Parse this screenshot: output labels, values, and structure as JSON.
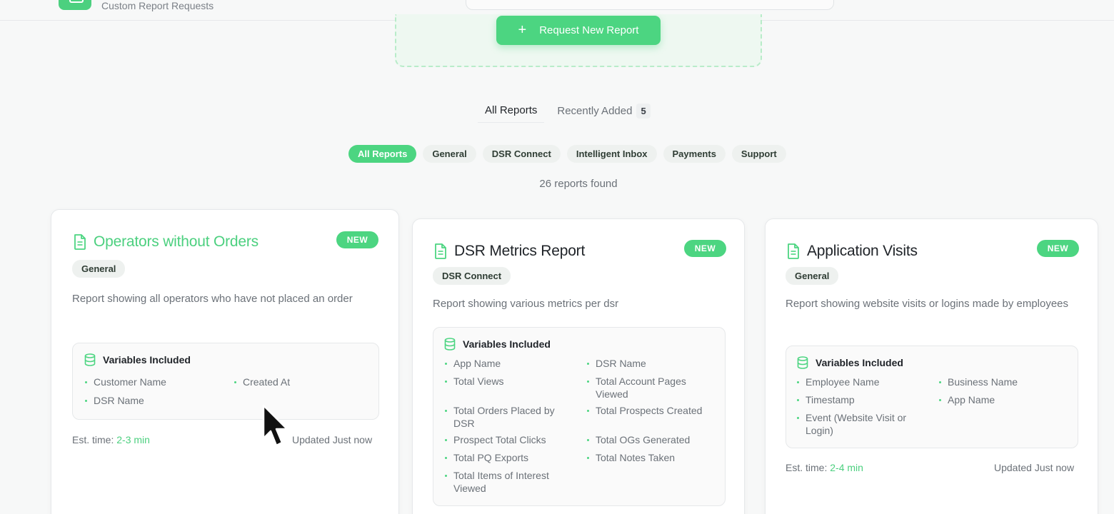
{
  "header": {
    "subtitle": "Custom Report Requests"
  },
  "request_button": {
    "label": "Request New Report",
    "plus": "+"
  },
  "tabs": [
    {
      "label": "All Reports"
    },
    {
      "label": "Recently Added",
      "count": "5"
    }
  ],
  "filters": [
    "All Reports",
    "General",
    "DSR Connect",
    "Intelligent Inbox",
    "Payments",
    "Support"
  ],
  "reports_found": "26 reports found",
  "cards": [
    {
      "title": "Operators without Orders",
      "badge": "NEW",
      "category": "General",
      "description": "Report showing all operators who have not placed an order",
      "variables_title": "Variables Included",
      "variables": [
        "Customer Name",
        "Created At",
        "DSR Name"
      ],
      "est_label": "Est. time:",
      "est_time": "2-3 min",
      "updated": "Updated Just now"
    },
    {
      "title": "DSR Metrics Report",
      "badge": "NEW",
      "category": "DSR Connect",
      "description": "Report showing various metrics per dsr",
      "variables_title": "Variables Included",
      "variables": [
        "App Name",
        "DSR Name",
        "Total Views",
        "Total Account Pages Viewed",
        "Total Orders Placed by DSR",
        "Total Prospects Created",
        "Prospect Total Clicks",
        "Total OGs Generated",
        "Total PQ Exports",
        "Total Notes Taken",
        "Total Items of Interest Viewed"
      ]
    },
    {
      "title": "Application Visits",
      "badge": "NEW",
      "category": "General",
      "description": "Report showing website visits or logins made by employees",
      "variables_title": "Variables Included",
      "variables": [
        "Employee Name",
        "Business Name",
        "Timestamp",
        "App Name",
        "Event (Website Visit or Login)"
      ],
      "est_label": "Est. time:",
      "est_time": "2-4 min",
      "updated": "Updated Just now"
    }
  ],
  "colors": {
    "accent": "#4cd581",
    "accent_text": "#4cd07f"
  },
  "icons": [
    "document-icon",
    "database-icon",
    "plus-icon",
    "mouse-cursor"
  ]
}
